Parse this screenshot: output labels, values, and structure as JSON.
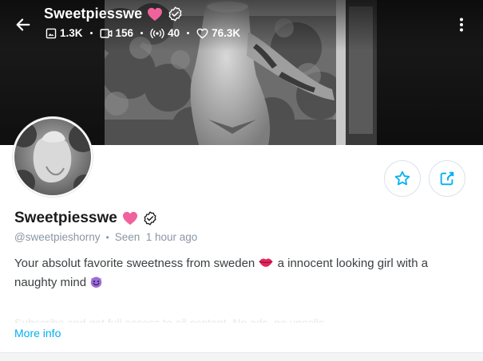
{
  "header": {
    "back_icon": "arrow-left-icon",
    "name": "Sweetpiesswe",
    "menu_icon": "more-vertical-icon",
    "stats": [
      {
        "icon": "image-icon",
        "value": "1.3K"
      },
      {
        "icon": "video-icon",
        "value": "156"
      },
      {
        "icon": "broadcast-icon",
        "value": "40"
      },
      {
        "icon": "heart-outline-icon",
        "value": "76.3K"
      }
    ]
  },
  "profile": {
    "name": "Sweetpiesswe",
    "handle": "@sweetpieshorny",
    "last_seen": "Seen  1 hour ago",
    "bio_part1": "Your absolut favorite sweetness from sweden",
    "bio_part2": " a innocent looking girl with a naughty mind",
    "bio_more": "Subscribe and get full access to all content. No ads, no upsells...",
    "more_info_label": "More info"
  },
  "actions": {
    "favorite_icon": "star-icon",
    "share_icon": "share-icon"
  },
  "colors": {
    "accent": "#00aff0",
    "heart_badge": "#f0629c",
    "muted_text": "#8a96a3",
    "body_text": "#3c4043"
  }
}
